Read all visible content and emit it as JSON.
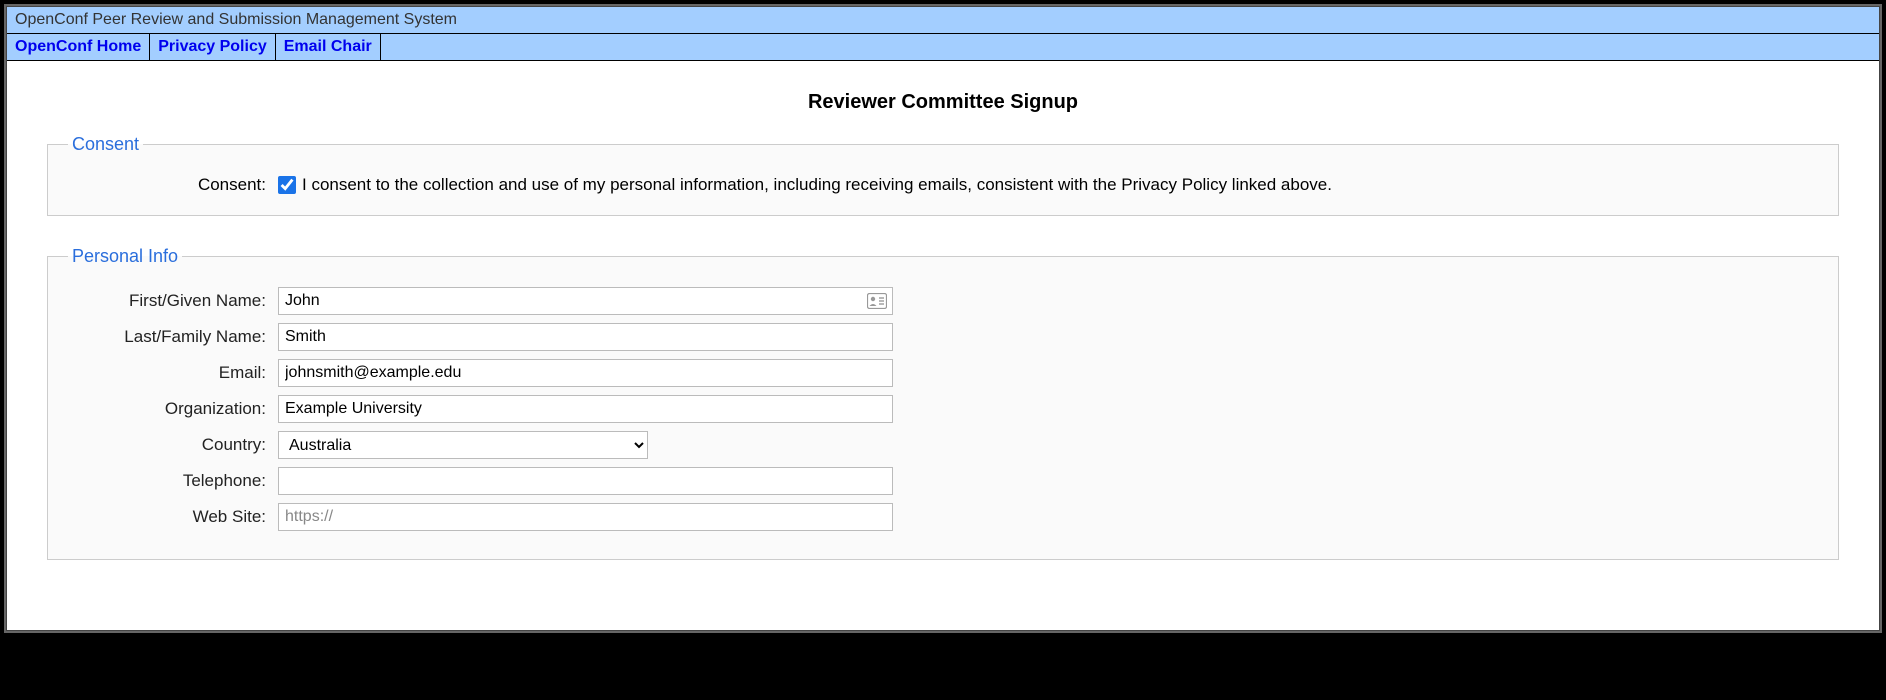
{
  "header": {
    "title": "OpenConf Peer Review and Submission Management System"
  },
  "nav": {
    "home": "OpenConf Home",
    "privacy": "Privacy Policy",
    "email_chair": "Email Chair"
  },
  "page": {
    "title": "Reviewer Committee Signup"
  },
  "consent": {
    "legend": "Consent",
    "label": "Consent:",
    "checked": true,
    "text": "I consent to the collection and use of my personal information, including receiving emails, consistent with the Privacy Policy linked above."
  },
  "personal": {
    "legend": "Personal Info",
    "first_name": {
      "label": "First/Given Name:",
      "value": "John"
    },
    "last_name": {
      "label": "Last/Family Name:",
      "value": "Smith"
    },
    "email": {
      "label": "Email:",
      "value": "johnsmith@example.edu"
    },
    "organization": {
      "label": "Organization:",
      "value": "Example University"
    },
    "country": {
      "label": "Country:",
      "selected": "Australia"
    },
    "telephone": {
      "label": "Telephone:",
      "value": ""
    },
    "website": {
      "label": "Web Site:",
      "value": "",
      "placeholder": "https://"
    }
  }
}
